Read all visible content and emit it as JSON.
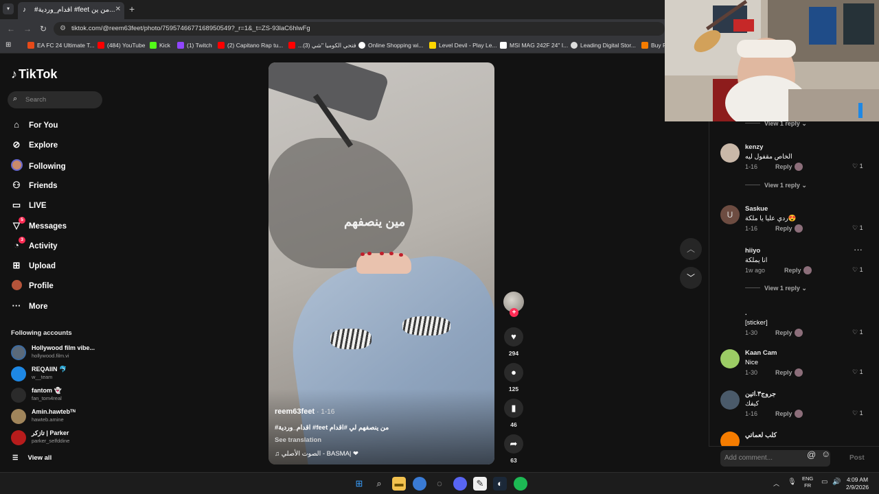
{
  "browser": {
    "tab_title": "#اقدام_وردية #feet من ين...",
    "url": "tiktok.com/@reem63feet/photo/7595746677168950549?_r=1&_t=ZS-93laC6hlwFg",
    "bookmarks": [
      {
        "label": "EA FC 24 Ultimate T...",
        "color": "#e64a19"
      },
      {
        "label": "(484) YouTube",
        "color": "#ff0000"
      },
      {
        "label": "Kick",
        "color": "#53fc18"
      },
      {
        "label": "(1) Twitch",
        "color": "#9146ff"
      },
      {
        "label": "(2) Capitano Rap tu...",
        "color": "#ff0000"
      },
      {
        "label": "...(3) فتحي الكوميا \"شي",
        "color": "#ff0000"
      },
      {
        "label": "Online Shopping wi...",
        "color": "#ffffff"
      },
      {
        "label": "Level Devil - Play Le...",
        "color": "#ffd600"
      },
      {
        "label": "MSI MAG 242F 24\" I...",
        "color": "#ffffff"
      },
      {
        "label": "Leading Digital Stor...",
        "color": "#dddddd"
      },
      {
        "label": "Buy P",
        "color": "#f57c00"
      }
    ]
  },
  "sidebar": {
    "logo": "TikTok",
    "search_placeholder": "Search",
    "nav": [
      {
        "label": "For You",
        "icon": "home-icon",
        "glyph": "⌂"
      },
      {
        "label": "Explore",
        "icon": "compass-icon",
        "glyph": "⊘"
      },
      {
        "label": "Following",
        "icon": "following-avatar-icon",
        "glyph": "●"
      },
      {
        "label": "Friends",
        "icon": "friends-icon",
        "glyph": "👥"
      },
      {
        "label": "LIVE",
        "icon": "live-icon",
        "glyph": "▭"
      },
      {
        "label": "Messages",
        "icon": "messages-icon",
        "glyph": "▽",
        "badge": "5"
      },
      {
        "label": "Activity",
        "icon": "activity-icon",
        "glyph": "◔",
        "badge": "3"
      },
      {
        "label": "Upload",
        "icon": "upload-icon",
        "glyph": "⊞"
      },
      {
        "label": "Profile",
        "icon": "profile-avatar-icon",
        "glyph": "●"
      },
      {
        "label": "More",
        "icon": "more-icon",
        "glyph": "···"
      }
    ],
    "following_title": "Following accounts",
    "accounts": [
      {
        "name": "Hollywood film vibe...",
        "handle": "hollywood.film.vi",
        "color": "#5b6a7a"
      },
      {
        "name": "REQAIIN 🐬",
        "handle": "w__team",
        "color": "#1e88e5"
      },
      {
        "name": "fantom 👻",
        "handle": "fan_tom4real",
        "color": "#2b2b2b"
      },
      {
        "name": "Amin.hawtebᵀᴺ",
        "handle": "hawteb.amine",
        "color": "#a0855b"
      },
      {
        "name": "تازكر | Parker",
        "handle": "parker_selfddine",
        "color": "#b71c1c"
      }
    ],
    "view_all": "View all"
  },
  "video": {
    "overlay_text": "مين ينصفهم",
    "author": "reem63feet",
    "date": "· 1-16",
    "caption": "#اقدام_وردية #feet من ينصفهم لي #اقدام",
    "see_translation": "See translation",
    "sound": "♫  الصوت الأصلي - BASMA| ❤"
  },
  "actions": {
    "likes": "294",
    "comments": "125",
    "saves": "46",
    "shares": "63"
  },
  "comments": {
    "view_reply": "View 1 reply",
    "items": [
      {
        "name": "kenzy",
        "text": "الخاص مقفول ليه",
        "date": "1-16",
        "likes": "1",
        "avatar_color": "#c9b8a8",
        "avatar_glyph": ""
      },
      {
        "name": "Saskue",
        "text": "ردي عليا يا ملكة😍",
        "date": "1-16",
        "likes": "1",
        "avatar_color": "#6d4c41",
        "avatar_glyph": "U"
      },
      {
        "name": "hiiyo",
        "text": "انا يملكة",
        "date": "1w ago",
        "likes": "1",
        "avatar_color": "#121212",
        "avatar_glyph": ""
      },
      {
        "name": ".",
        "text": "[sticker]",
        "date": "1-30",
        "likes": "1",
        "avatar_color": "#121212",
        "avatar_glyph": ""
      },
      {
        "name": "Kaan Cam",
        "text": "Nice",
        "date": "1-30",
        "likes": "1",
        "avatar_color": "#9ccc65",
        "avatar_glyph": ""
      },
      {
        "name": "جروج٣.اتين",
        "text": "كيفك",
        "date": "1-16",
        "likes": "1",
        "avatar_color": "#4a5a6a",
        "avatar_glyph": ""
      },
      {
        "name": "كلب لعماتي",
        "text": "",
        "date": "",
        "likes": "",
        "avatar_color": "#f57c00",
        "avatar_glyph": ""
      }
    ],
    "reply_label": "Reply",
    "add_placeholder": "Add comment...",
    "post_label": "Post"
  },
  "taskbar": {
    "lang_top": "ENG",
    "lang_bottom": "FR",
    "time": "4:09 AM",
    "date": "2/9/2026"
  }
}
